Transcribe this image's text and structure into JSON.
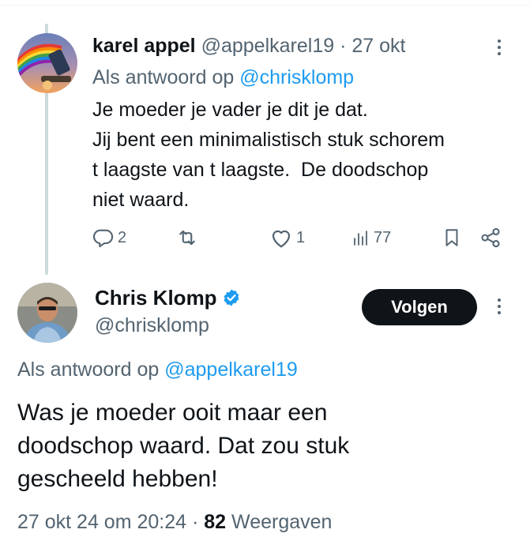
{
  "reply_tweet": {
    "name": "karel appel",
    "handle": "@appelkarel19",
    "separator": "·",
    "date": "27 okt",
    "reply_prefix": "Als antwoord op",
    "reply_to": "@chrisklomp",
    "text_lines": [
      "Je moeder je vader je dit je dat.",
      "Jij bent een minimalistisch stuk schorem",
      "t laagste van t laagste.  De doodschop",
      "niet waard."
    ],
    "actions": {
      "replies": "2",
      "reposts": "",
      "likes": "1",
      "views": "77"
    },
    "icons": [
      "reply-icon",
      "repost-icon",
      "like-icon",
      "views-icon",
      "bookmark-icon",
      "share-icon",
      "more-icon"
    ]
  },
  "main_tweet": {
    "name": "Chris Klomp",
    "verified": true,
    "handle": "@chrisklomp",
    "follow_label": "Volgen",
    "reply_prefix": "Als antwoord op",
    "reply_to": "@appelkarel19",
    "text_lines": [
      "Was je moeder ooit maar een",
      "doodschop waard. Dat zou stuk",
      "gescheeld hebben!"
    ],
    "timestamp": "27 okt 24 om 20:24",
    "separator": "·",
    "views_count": "82",
    "views_label": "Weergaven"
  },
  "colors": {
    "text": "#0f1419",
    "muted": "#536471",
    "link": "#1d9bf0",
    "verified": "#1d9bf0",
    "follow_bg": "#0f1419",
    "thread_line": "#cfd9de"
  }
}
